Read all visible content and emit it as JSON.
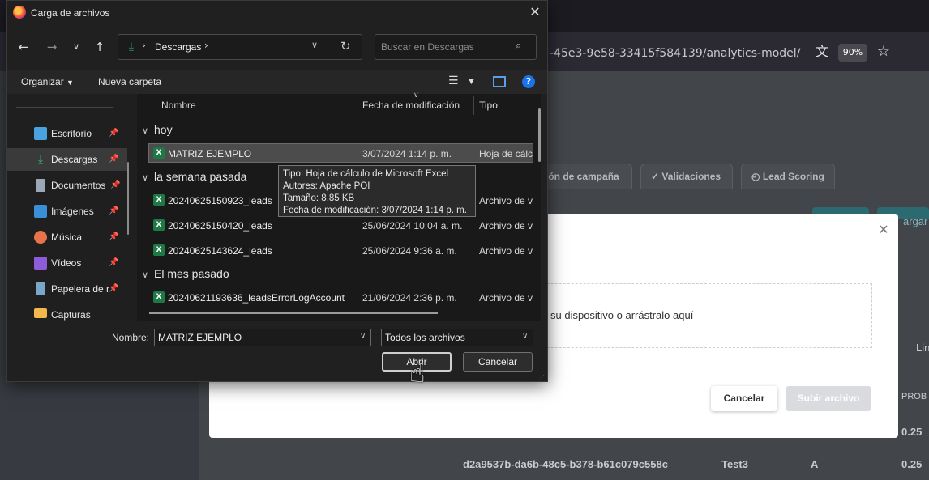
{
  "browser": {
    "url_fragment": "-45e3-9e58-33415f584139/analytics-model/",
    "zoom": "90%",
    "translate_icon": "translate-icon",
    "bookmark_icon": "star-icon"
  },
  "background_page": {
    "tabs": [
      "ión de campaña",
      "Validaciones",
      "Lead Scoring"
    ],
    "button_partial": "argar M",
    "column_partial": "Lin",
    "column_prob": "PROB",
    "rows": [
      {
        "value": "0.25"
      },
      {
        "id": "d2a9537b-da6b-48c5-b378-b61c079c558c",
        "name": "Test3",
        "grade": "A",
        "value": "0.25"
      }
    ]
  },
  "modal": {
    "dropzone_text": "su dispositivo o arrástralo aquí",
    "cancel_label": "Cancelar",
    "upload_label": "Subir archivo"
  },
  "dialog": {
    "title": "Carga de archivos",
    "address": {
      "folder": "Descargas"
    },
    "search_placeholder": "Buscar en Descargas",
    "toolbar": {
      "organize": "Organizar",
      "new_folder": "Nueva carpeta"
    },
    "nav_items": [
      {
        "label": "Escritorio",
        "color": "#4aa3df"
      },
      {
        "label": "Descargas",
        "color": "#3cb371"
      },
      {
        "label": "Documentos",
        "color": "#9aa8b8"
      },
      {
        "label": "Imágenes",
        "color": "#3b8ed8"
      },
      {
        "label": "Música",
        "color": "#e8734a"
      },
      {
        "label": "Vídeos",
        "color": "#8e5cd9"
      },
      {
        "label": "Papelera de r",
        "color": "#7aa6c8"
      },
      {
        "label": "Capturas",
        "color": "#f2b84b"
      }
    ],
    "columns": {
      "name": "Nombre",
      "modified": "Fecha de modificación",
      "type": "Tipo"
    },
    "groups": [
      {
        "label": "hoy",
        "files": [
          {
            "name": "MATRIZ EJEMPLO",
            "date": "3/07/2024 1:14 p. m.",
            "type": "Hoja de cálculo"
          }
        ]
      },
      {
        "label": "la semana pasada",
        "files": [
          {
            "name": "20240625150923_leads",
            "date": "",
            "type": "Archivo de v"
          },
          {
            "name": "20240625150420_leads",
            "date": "25/06/2024 10:04 a. m.",
            "type": "Archivo de v"
          },
          {
            "name": "20240625143624_leads",
            "date": "25/06/2024 9:36 a. m.",
            "type": "Archivo de v"
          }
        ]
      },
      {
        "label": "El mes pasado",
        "files": [
          {
            "name": "20240621193636_leadsErrorLogAccount",
            "date": "21/06/2024 2:36 p. m.",
            "type": "Archivo de v"
          }
        ]
      }
    ],
    "tooltip": [
      "Tipo: Hoja de cálculo de Microsoft Excel",
      "Autores: Apache POI",
      "Tamaño: 8,85 KB",
      "Fecha de modificación: 3/07/2024 1:14 p. m."
    ],
    "name_label": "Nombre:",
    "name_value": "MATRIZ EJEMPLO",
    "filter_value": "Todos los archivos",
    "open_label": "Abrir",
    "cancel_label": "Cancelar"
  }
}
